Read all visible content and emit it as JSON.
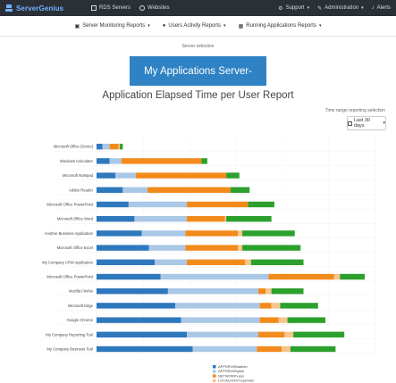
{
  "topbar": {
    "brand": "ServerGenius",
    "links": [
      {
        "label": "RDS Servers",
        "icon": "server-icon"
      },
      {
        "label": "Websites",
        "icon": "globe-icon"
      }
    ],
    "right": [
      {
        "label": "Support",
        "icon": "gear-icon"
      },
      {
        "label": "Administration",
        "icon": "wrench-icon"
      },
      {
        "label": "Alerts",
        "icon": "bell-icon"
      }
    ]
  },
  "subnav": [
    {
      "label": "Server Monitoring Reports",
      "icon": "monitor-icon"
    },
    {
      "label": "Users Activity Reports",
      "icon": "user-icon"
    },
    {
      "label": "Running Applications Reports",
      "icon": "grid-icon"
    }
  ],
  "server_selection_label": "Server selection",
  "server_name": "My Applications Server-",
  "report_title": "Application Elapsed Time per User Report",
  "time_range_label": "Time range reporting selection",
  "time_range_value": "Last 30 days",
  "colors": {
    "blue": "#2e78bd",
    "lightblue": "#aac8e6",
    "orange": "#f28a1c",
    "peach": "#f7c48b",
    "green": "#2ca02c"
  },
  "chart_data": {
    "type": "bar",
    "orientation": "horizontal",
    "stacked": true,
    "categories": [
      "Microsoft Office (Demo)",
      "Windows Calculator",
      "Microsoft Notepad",
      "Adobe Reader",
      "Microsoft Office PowerPoint",
      "Microsoft Office Word",
      "Another Business Application",
      "Microsoft Office Excel",
      "My Company CRM Application",
      "Microsoft Office PowerPoint",
      "Mozilla Firefox",
      "Microsoft Edge",
      "Google Chrome",
      "My Company Reporting Tool",
      "My Company Business Tool"
    ],
    "series": [
      {
        "name": "APPSRV08\\admin",
        "color": "blue",
        "values": [
          4,
          9,
          13,
          18,
          22,
          26,
          31,
          36,
          40,
          44,
          49,
          54,
          58,
          62,
          66
        ]
      },
      {
        "name": "APPSRV08\\jdoe",
        "color": "lightblue",
        "values": [
          5,
          8,
          14,
          17,
          40,
          36,
          30,
          25,
          22,
          74,
          62,
          58,
          54,
          49,
          44
        ]
      },
      {
        "name": "NETWORK\\user",
        "color": "orange",
        "values": [
          6,
          55,
          62,
          57,
          42,
          26,
          36,
          36,
          40,
          45,
          5,
          8,
          13,
          18,
          17
        ]
      },
      {
        "name": "LOCALHOST\\operator",
        "color": "peach",
        "values": [
          1,
          0,
          0,
          0,
          0,
          1,
          3,
          3,
          4,
          4,
          4,
          6,
          6,
          6,
          6
        ]
      },
      {
        "name": "",
        "color": "green",
        "values": [
          2,
          4,
          9,
          13,
          18,
          31,
          36,
          40,
          36,
          17,
          22,
          26,
          26,
          35,
          31
        ]
      }
    ],
    "legend_position": "bottom",
    "grid": true
  }
}
